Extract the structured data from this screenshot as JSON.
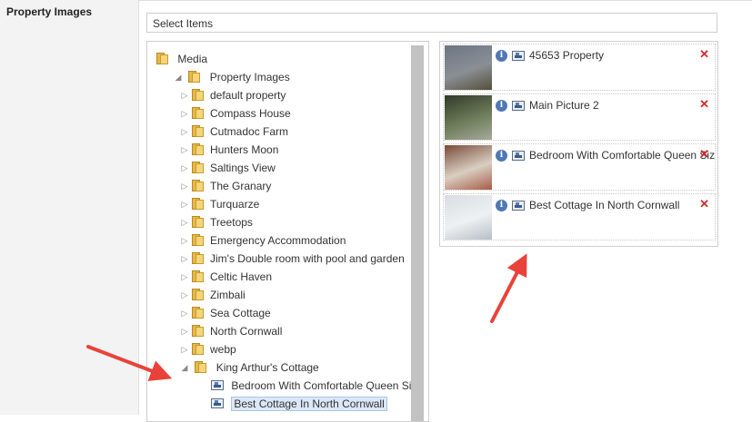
{
  "section": {
    "label": "Property Images"
  },
  "select_bar": {
    "label": "Select Items"
  },
  "tree": {
    "root": {
      "label": "Media",
      "icon": "folder-icon"
    },
    "parent": {
      "label": "Property Images",
      "icon": "folder-icon",
      "expanded": true
    },
    "folders": [
      {
        "label": "default property"
      },
      {
        "label": "Compass House"
      },
      {
        "label": "Cutmadoc Farm"
      },
      {
        "label": "Hunters Moon"
      },
      {
        "label": "Saltings View"
      },
      {
        "label": "The Granary"
      },
      {
        "label": "Turquarze"
      },
      {
        "label": "Treetops"
      },
      {
        "label": "Emergency Accommodation"
      },
      {
        "label": "Jim's Double room with pool and garden"
      },
      {
        "label": "Celtic Haven"
      },
      {
        "label": "Zimbali"
      },
      {
        "label": "Sea Cottage"
      },
      {
        "label": "North Cornwall"
      },
      {
        "label": "webp"
      }
    ],
    "expanded_folder": {
      "label": "King Arthur's Cottage",
      "expanded": true
    },
    "leaves": [
      {
        "label": "Bedroom With Comfortable Queen Si",
        "selected": false
      },
      {
        "label": "Best Cottage In North Cornwall",
        "selected": true
      }
    ]
  },
  "picked_items": [
    {
      "name": "45653 Property",
      "thumb_colors": [
        "#6b7684",
        "#8a8f94",
        "#55503c"
      ]
    },
    {
      "name": "Main Picture 2",
      "thumb_colors": [
        "#2f3a28",
        "#6e7d5a",
        "#a7a99c"
      ]
    },
    {
      "name": "Bedroom With Comfortable Queen Size",
      "thumb_colors": [
        "#7a4a3a",
        "#d9cfc2",
        "#a85b48"
      ]
    },
    {
      "name": "Best Cottage In North Cornwall",
      "thumb_colors": [
        "#d8dde2",
        "#eef1f3",
        "#b7bec6"
      ]
    }
  ],
  "colors": {
    "folder": "#e6b84a",
    "remove": "#d42a2a",
    "info": "#4f78b5",
    "annotation_arrow": "#e8423a"
  }
}
